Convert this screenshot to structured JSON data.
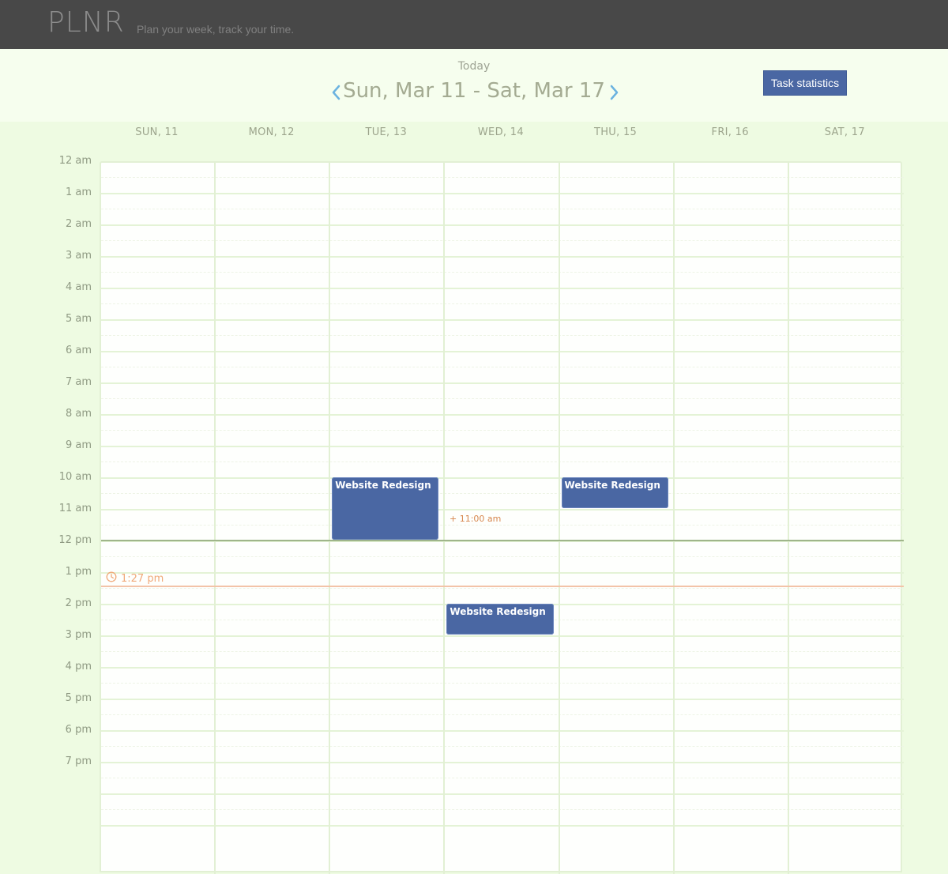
{
  "header": {
    "logo": "PLNR",
    "tagline": "Plan your week, track your time."
  },
  "week": {
    "today_label": "Today",
    "title": "Sun, Mar 11 - Sat, Mar 17",
    "prev_icon": "chevron-left-icon",
    "next_icon": "chevron-right-icon",
    "stats_button": "Task statistics"
  },
  "days": [
    {
      "label": "SUN, 11"
    },
    {
      "label": "MON, 12"
    },
    {
      "label": "TUE, 13"
    },
    {
      "label": "WED, 14"
    },
    {
      "label": "THU, 15"
    },
    {
      "label": "FRI, 16"
    },
    {
      "label": "SAT, 17"
    }
  ],
  "hours": [
    "12 am",
    "1 am",
    "2 am",
    "3 am",
    "4 am",
    "5 am",
    "6 am",
    "7 am",
    "8 am",
    "9 am",
    "10 am",
    "11 am",
    "12 pm",
    "1 pm",
    "2 pm",
    "3 pm",
    "4 pm",
    "5 pm",
    "6 pm",
    "7 pm"
  ],
  "now": {
    "time": "1:27 pm",
    "icon": "clock-icon"
  },
  "events": [
    {
      "title": "Website Redesign",
      "day": "TUE, 13",
      "start": "10 am",
      "end": "12 pm"
    },
    {
      "title": "Website Redesign",
      "day": "THU, 15",
      "start": "10 am",
      "end": "11 am"
    },
    {
      "title": "Website Redesign",
      "day": "WED, 14",
      "start": "2 pm",
      "end": "3 pm"
    }
  ],
  "time_note": "+ 11:00 am",
  "colors": {
    "topbar": "#484848",
    "background": "#eefbe2",
    "event": "#4a67a3",
    "now_line": "#f3c3a8",
    "noon_line": "#9fb58a",
    "time_note": "#d7874f"
  }
}
